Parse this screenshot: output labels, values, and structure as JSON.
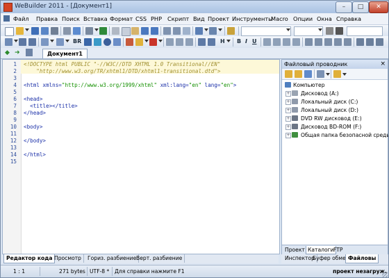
{
  "window": {
    "title": "WeBuilder 2011 - [Документ1]",
    "min_glyph": "–",
    "max_glyph": "□",
    "close_glyph": "✕",
    "accent": "#d54424"
  },
  "menu": {
    "items": [
      "Файл",
      "Правка",
      "Поиск",
      "Вставка",
      "Формат",
      "CSS",
      "PHP",
      "Скрипт",
      "Вид",
      "Проект",
      "Инструменты",
      "Macro",
      "Опции",
      "Окна",
      "Справка"
    ]
  },
  "toolbar": {
    "br_label": "BR",
    "h_label": "H",
    "b_label": "B",
    "i_label": "I",
    "u_label": "U"
  },
  "tabs": {
    "document": "Документ1"
  },
  "editor": {
    "lines": [
      {
        "n": "1",
        "html": "doctype1"
      },
      {
        "n": "2",
        "html": "doctype2"
      },
      {
        "n": "3",
        "html": ""
      },
      {
        "n": "4",
        "html": "html"
      },
      {
        "n": "5",
        "html": ""
      },
      {
        "n": "6",
        "html": "head"
      },
      {
        "n": "7",
        "html": "title"
      },
      {
        "n": "8",
        "html": "headclose"
      },
      {
        "n": "9",
        "html": ""
      },
      {
        "n": "10",
        "html": "body"
      },
      {
        "n": "11",
        "html": ""
      },
      {
        "n": "12",
        "html": "bodyclose"
      },
      {
        "n": "13",
        "html": ""
      },
      {
        "n": "14",
        "html": "htmlclose"
      },
      {
        "n": "15",
        "html": ""
      }
    ],
    "code": {
      "doctype1": "<!DOCTYPE html PUBLIC \"-//W3C//DTD XHTML 1.0 Transitional//EN\"",
      "doctype2": "    \"http://www.w3.org/TR/xhtml1/DTD/xhtml1-transitional.dtd\">",
      "html_tag": "<html",
      "html_attr1": " xmlns=",
      "html_val1": "\"http://www.w3.org/1999/xhtml\"",
      "html_attr2": " xml:lang=",
      "html_val2": "\"en\"",
      "html_attr3": " lang=",
      "html_val3": "\"en\"",
      "html_end": ">",
      "head": "<head>",
      "title": "  <title></title>",
      "headclose": "</head>",
      "body": "<body>",
      "bodyclose": "</body>",
      "htmlclose": "</html>"
    }
  },
  "explorer": {
    "title": "Файловый проводник",
    "close": "×",
    "root": "Компьютер",
    "items": [
      "Дисковод (A:)",
      "Локальный диск (C:)",
      "Локальный диск (D:)",
      "DVD RW дисковод (E:)",
      "Дисковод BD-ROM (F:)",
      "Общая папка безопасной среды"
    ],
    "tabs": [
      "Проект",
      "Каталоги",
      "FTP"
    ],
    "active_tab": "Каталоги"
  },
  "bottom_tabs": [
    "Редактор кода",
    "Просмотр",
    "Гориз. разбиение",
    "Верт. разбиение"
  ],
  "panel_bottom_tabs": [
    "Инспектор",
    "Буфер обмена",
    "Файловы"
  ],
  "status": {
    "position": "1 : 1",
    "size": "271 bytes",
    "encoding": "UTF-8 *",
    "help": "Для справки нажмите F1",
    "project": "проект незагруж."
  }
}
